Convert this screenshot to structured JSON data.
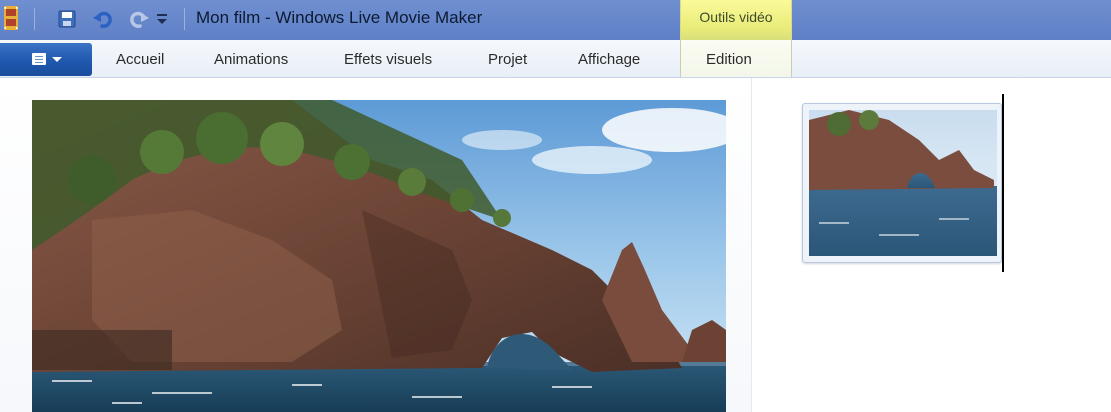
{
  "window": {
    "title": "Mon film - Windows Live Movie Maker",
    "context_tab_group": "Outils vidéo"
  },
  "quick_access_toolbar": {
    "icons": [
      "app-icon",
      "save-icon",
      "undo-icon",
      "redo-icon",
      "customize-dropdown-icon"
    ]
  },
  "ribbon": {
    "tabs": [
      {
        "label": "Accueil"
      },
      {
        "label": "Animations"
      },
      {
        "label": "Effets visuels"
      },
      {
        "label": "Projet"
      },
      {
        "label": "Affichage"
      },
      {
        "label": "Edition"
      }
    ]
  },
  "colors": {
    "titlebar": "#6685cc",
    "context_tab": "#eef08a",
    "app_button": "#2a62b8"
  }
}
